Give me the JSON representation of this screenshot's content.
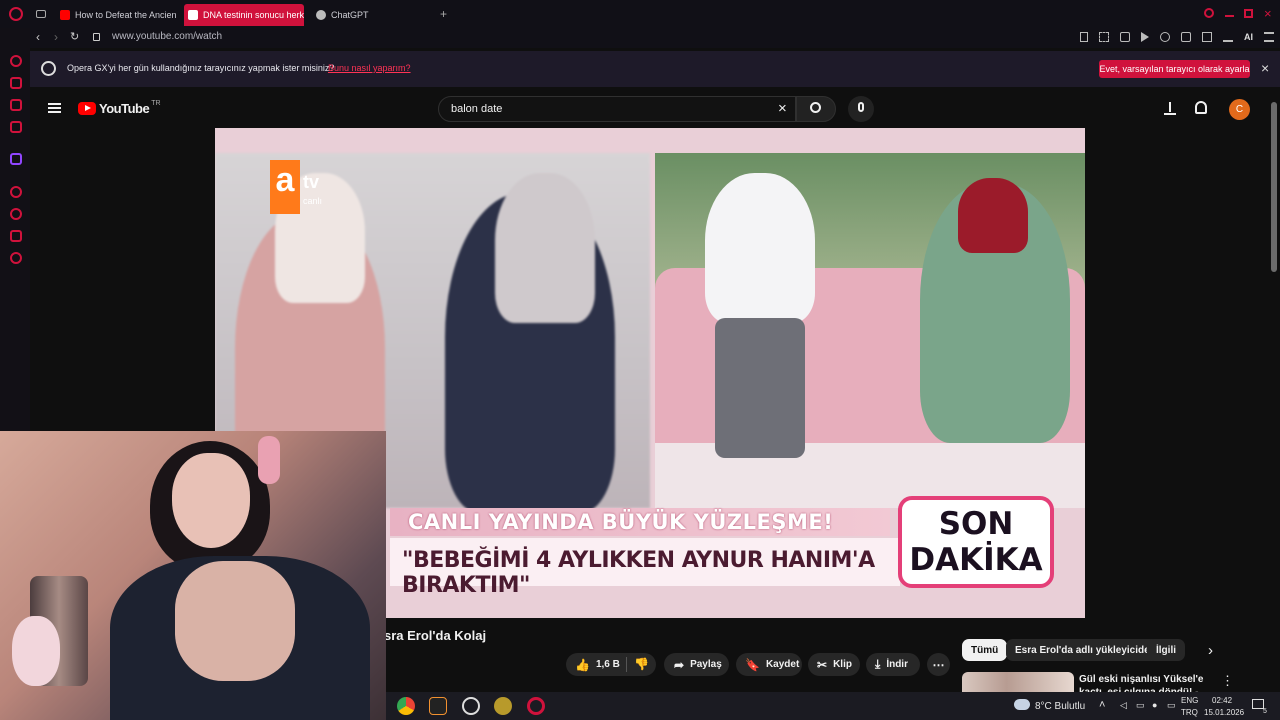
{
  "browser": {
    "tabs": [
      {
        "label": "How to Defeat the Ancient",
        "favicon": "youtube-icon",
        "active": false
      },
      {
        "label": "DNA testinin sonucu herk",
        "favicon": "youtube-icon",
        "active": true
      },
      {
        "label": "ChatGPT",
        "favicon": "chatgpt-icon",
        "active": false
      }
    ],
    "url": "www.youtube.com/watch",
    "accent_color": "#d0123c"
  },
  "notification": {
    "text": "Opera GX'yi her gün kullandığınız tarayıcınız yapmak ister misiniz?",
    "link": "Bunu nasıl yaparım?",
    "button": "Evet, varsayılan tarayıcı olarak ayarla"
  },
  "youtube": {
    "logo_text": "YouTube",
    "region": "TR",
    "search_value": "balon date",
    "avatar_letter": "C"
  },
  "video": {
    "channel_badge_a": "a",
    "channel_badge_tv": "tv",
    "channel_badge_canli": "canlı",
    "headline": "CANLI YAYINDA BÜYÜK YÜZLEŞME!",
    "quote": "\"BEBEĞİMİ 4 AYLIKKEN AYNUR HANIM'A BIRAKTIM\"",
    "badge_line1": "SON",
    "badge_line2": "DAKİKA"
  },
  "below_video": {
    "title": "sra Erol'da Kolaj",
    "actions": {
      "like_count": "1,6 B",
      "share": "Paylaş",
      "save": "Kaydet",
      "clip": "Klip",
      "download": "İndir"
    }
  },
  "recommendations": {
    "chips": [
      "Tümü",
      "Esra Erol'da adlı yükleyiciden",
      "İlgili"
    ],
    "first_title": "Gül eski nişanlısı Yüksel'e kaçtı, eşi çılgına döndü! - Esra Erol'da"
  },
  "taskbar": {
    "weather": "8°C  Bulutlu",
    "lang_top": "ENG",
    "lang_bottom": "TRQ",
    "time": "02:42",
    "date": "15.01.2026",
    "notif_count": "5"
  }
}
